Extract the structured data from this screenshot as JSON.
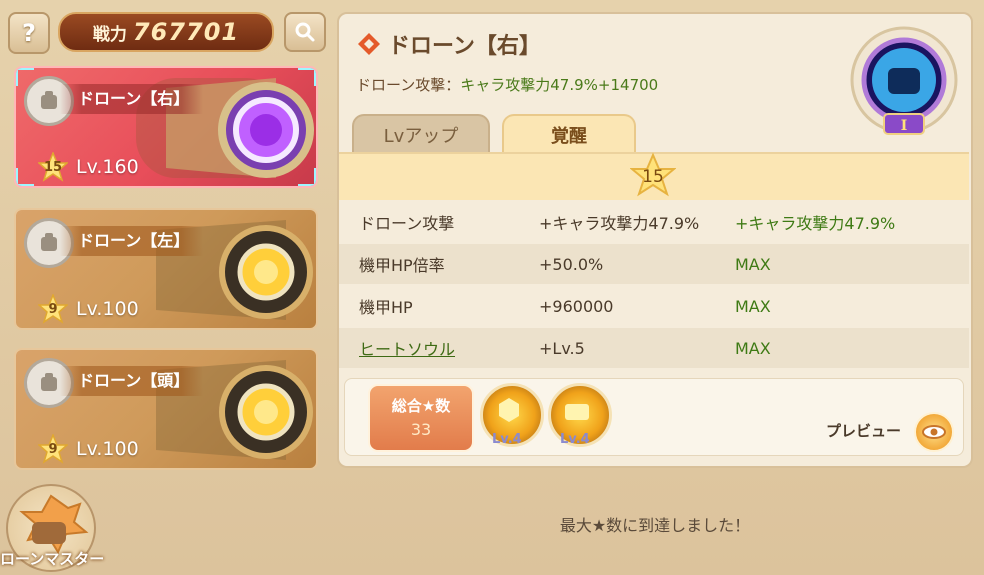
{
  "header": {
    "help_label": "?",
    "power_label": "戦力",
    "power_value": "767701"
  },
  "drone_list": [
    {
      "name": "ドローン【右】",
      "star": "15",
      "level": "Lv.160",
      "selected": true
    },
    {
      "name": "ドローン【左】",
      "star": "9",
      "level": "Lv.100",
      "selected": false
    },
    {
      "name": "ドローン【頭】",
      "star": "9",
      "level": "Lv.100",
      "selected": false
    }
  ],
  "master_button": {
    "label": "ローンマスター"
  },
  "detail": {
    "title": "ドローン【右】",
    "subtitle_prefix": "ドローン攻撃：",
    "subtitle_value": "キャラ攻撃力47.9%+14700",
    "emblem_rank": "I"
  },
  "tabs": [
    {
      "label": "Lvアップ",
      "active": false
    },
    {
      "label": "覚醒",
      "active": true
    }
  ],
  "star_level": "15",
  "stats": [
    {
      "name": "ドローン攻撃",
      "current": "+キャラ攻撃力47.9%",
      "next": "+キャラ攻撃力47.9%"
    },
    {
      "name": "機甲HP倍率",
      "current": "+50.0%",
      "next": "MAX"
    },
    {
      "name": "機甲HP",
      "current": "+960000",
      "next": "MAX"
    },
    {
      "name": "ヒートソウル",
      "current": "+Lv.5",
      "next": "MAX"
    }
  ],
  "total_stars": {
    "label": "総合★数",
    "value": "33"
  },
  "bonus_icons": [
    {
      "icon": "honeycomb-icon",
      "level": "Lv.4"
    },
    {
      "icon": "armor-icon",
      "level": "Lv.4"
    }
  ],
  "preview_label": "プレビュー",
  "status_message": "最大★数に到達しました！",
  "colors": {
    "accent_green": "#3e7a14",
    "selected_card": "#e84e5a",
    "tab_active": "#fbe6b4"
  }
}
